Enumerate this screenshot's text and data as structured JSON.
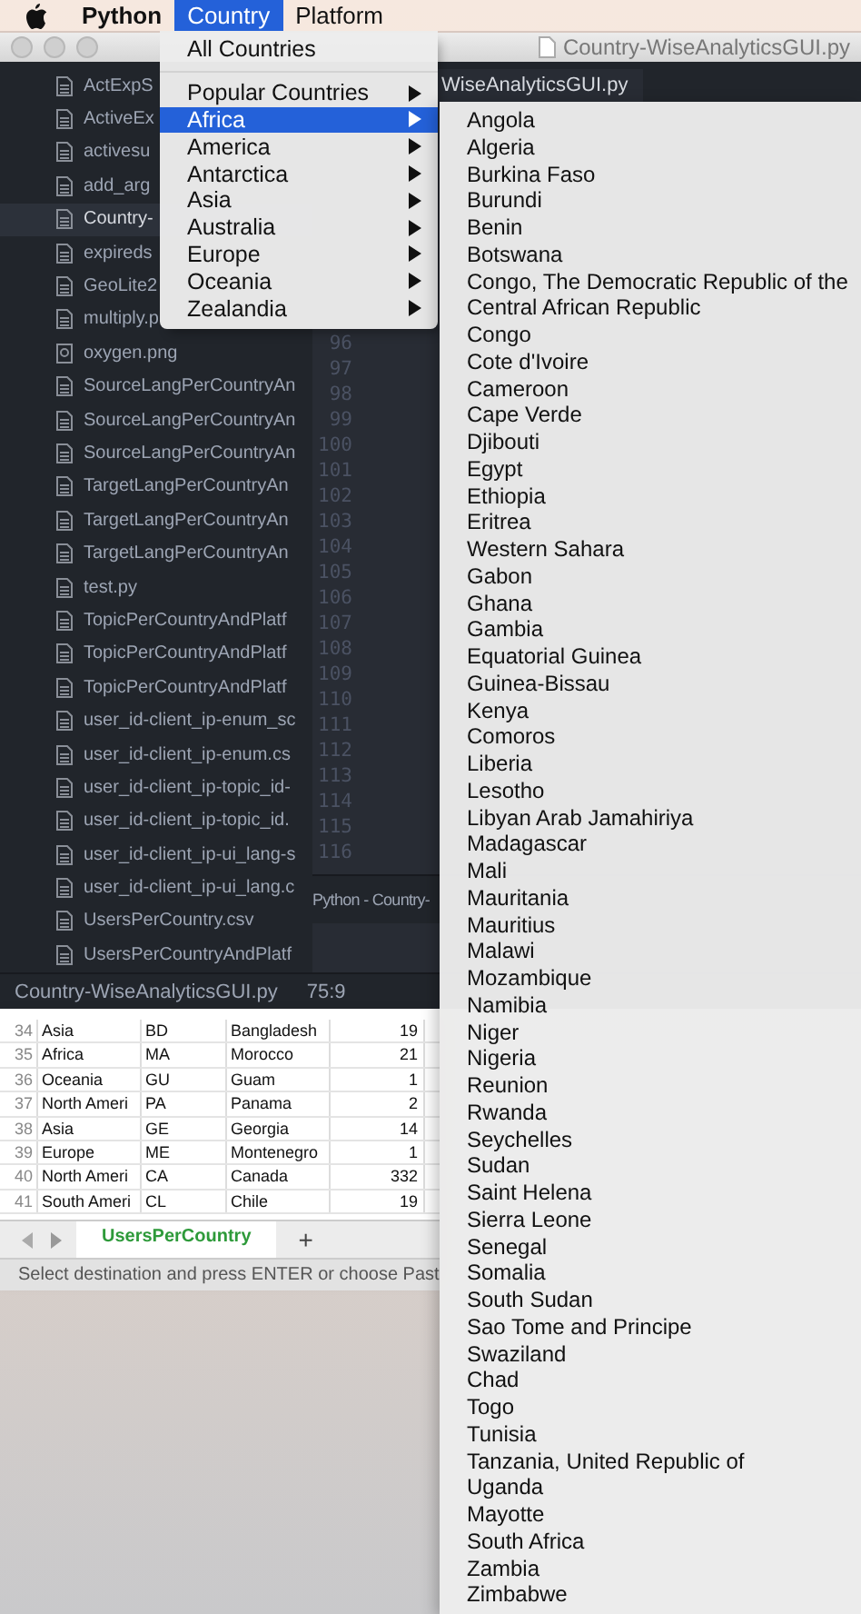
{
  "menu_bar": {
    "items": [
      {
        "label": "Python",
        "selected": false
      },
      {
        "label": "Country",
        "selected": true
      },
      {
        "label": "Platform",
        "selected": false
      }
    ]
  },
  "country_menu": {
    "items": [
      {
        "kind": "plain",
        "label": "All Countries",
        "selected": false
      },
      {
        "kind": "separator"
      },
      {
        "kind": "submenu",
        "label": "Popular Countries",
        "selected": false
      },
      {
        "kind": "submenu",
        "label": "Africa",
        "selected": true
      },
      {
        "kind": "submenu",
        "label": "America",
        "selected": false
      },
      {
        "kind": "submenu",
        "label": "Antarctica",
        "selected": false
      },
      {
        "kind": "submenu",
        "label": "Asia",
        "selected": false
      },
      {
        "kind": "submenu",
        "label": "Australia",
        "selected": false
      },
      {
        "kind": "submenu",
        "label": "Europe",
        "selected": false
      },
      {
        "kind": "submenu",
        "label": "Oceania",
        "selected": false
      },
      {
        "kind": "submenu",
        "label": "Zealandia",
        "selected": false
      }
    ]
  },
  "region_submenu": {
    "items": [
      "Angola",
      "Algeria",
      "Burkina Faso",
      "Burundi",
      "Benin",
      "Botswana",
      "Congo, The Democratic Republic of the",
      "Central African Republic",
      "Congo",
      "Cote d'Ivoire",
      "Cameroon",
      "Cape Verde",
      "Djibouti",
      "Egypt",
      "Ethiopia",
      "Eritrea",
      "Western Sahara",
      "Gabon",
      "Ghana",
      "Gambia",
      "Equatorial Guinea",
      "Guinea-Bissau",
      "Kenya",
      "Comoros",
      "Liberia",
      "Lesotho",
      "Libyan Arab Jamahiriya",
      "Madagascar",
      "Mali",
      "Mauritania",
      "Mauritius",
      "Malawi",
      "Mozambique",
      "Namibia",
      "Niger",
      "Nigeria",
      "Reunion",
      "Rwanda",
      "Seychelles",
      "Sudan",
      "Saint Helena",
      "Sierra Leone",
      "Senegal",
      "Somalia",
      "South Sudan",
      "Sao Tome and Principe",
      "Swaziland",
      "Chad",
      "Togo",
      "Tunisia",
      "Tanzania, United Republic of",
      "Uganda",
      "Mayotte",
      "South Africa",
      "Zambia",
      "Zimbabwe"
    ]
  },
  "editor": {
    "title": "Country-WiseAnalyticsGUI.py",
    "tab": "WiseAnalyticsGUI.py",
    "files": [
      {
        "name": "ActExpS",
        "kind": "file",
        "selected": false
      },
      {
        "name": "ActiveEx",
        "kind": "file",
        "selected": false
      },
      {
        "name": "activesu",
        "kind": "file",
        "selected": false
      },
      {
        "name": "add_arg",
        "kind": "file",
        "selected": false
      },
      {
        "name": "Country-",
        "kind": "file",
        "selected": true
      },
      {
        "name": "expireds",
        "kind": "file",
        "selected": false
      },
      {
        "name": "GeoLite2",
        "kind": "file",
        "selected": false
      },
      {
        "name": "multiply.p",
        "kind": "file",
        "selected": false
      },
      {
        "name": "oxygen.png",
        "kind": "image",
        "selected": false
      },
      {
        "name": "SourceLangPerCountryAn",
        "kind": "file",
        "selected": false
      },
      {
        "name": "SourceLangPerCountryAn",
        "kind": "file",
        "selected": false
      },
      {
        "name": "SourceLangPerCountryAn",
        "kind": "file",
        "selected": false
      },
      {
        "name": "TargetLangPerCountryAn",
        "kind": "file",
        "selected": false
      },
      {
        "name": "TargetLangPerCountryAn",
        "kind": "file",
        "selected": false
      },
      {
        "name": "TargetLangPerCountryAn",
        "kind": "file",
        "selected": false
      },
      {
        "name": "test.py",
        "kind": "file",
        "selected": false
      },
      {
        "name": "TopicPerCountryAndPlatf",
        "kind": "file",
        "selected": false
      },
      {
        "name": "TopicPerCountryAndPlatf",
        "kind": "file",
        "selected": false
      },
      {
        "name": "TopicPerCountryAndPlatf",
        "kind": "file",
        "selected": false
      },
      {
        "name": "user_id-client_ip-enum_sc",
        "kind": "file",
        "selected": false
      },
      {
        "name": "user_id-client_ip-enum.cs",
        "kind": "file",
        "selected": false
      },
      {
        "name": "user_id-client_ip-topic_id-",
        "kind": "file",
        "selected": false
      },
      {
        "name": "user_id-client_ip-topic_id.",
        "kind": "file",
        "selected": false
      },
      {
        "name": "user_id-client_ip-ui_lang-s",
        "kind": "file",
        "selected": false
      },
      {
        "name": "user_id-client_ip-ui_lang.c",
        "kind": "file",
        "selected": false
      },
      {
        "name": "UsersPerCountry.csv",
        "kind": "file",
        "selected": false
      },
      {
        "name": "UsersPerCountryAndPlatf",
        "kind": "file",
        "selected": false
      }
    ],
    "line_numbers": [
      "96",
      "97",
      "98",
      "99",
      "100",
      "101",
      "102",
      "103",
      "104",
      "105",
      "106",
      "107",
      "108",
      "109",
      "110",
      "111",
      "112",
      "113",
      "114",
      "115",
      "116"
    ],
    "panel_label": "Python - Country-",
    "status_file": "Country-WiseAnalyticsGUI.py",
    "status_position": "75:9"
  },
  "spreadsheet": {
    "rows": [
      {
        "number": "34",
        "cells": [
          "Asia",
          "BD",
          "Bangladesh",
          "19"
        ]
      },
      {
        "number": "35",
        "cells": [
          "Africa",
          "MA",
          "Morocco",
          "21"
        ]
      },
      {
        "number": "36",
        "cells": [
          "Oceania",
          "GU",
          "Guam",
          "1"
        ]
      },
      {
        "number": "37",
        "cells": [
          "North Ameri",
          "PA",
          "Panama",
          "2"
        ]
      },
      {
        "number": "38",
        "cells": [
          "Asia",
          "GE",
          "Georgia",
          "14"
        ]
      },
      {
        "number": "39",
        "cells": [
          "Europe",
          "ME",
          "Montenegro",
          "1"
        ]
      },
      {
        "number": "40",
        "cells": [
          "North Ameri",
          "CA",
          "Canada",
          "332"
        ]
      },
      {
        "number": "41",
        "cells": [
          "South Ameri",
          "CL",
          "Chile",
          "19"
        ]
      }
    ],
    "sheet_tab": "UsersPerCountry",
    "add_tab": "+",
    "status": "Select destination and press ENTER or choose Past"
  }
}
